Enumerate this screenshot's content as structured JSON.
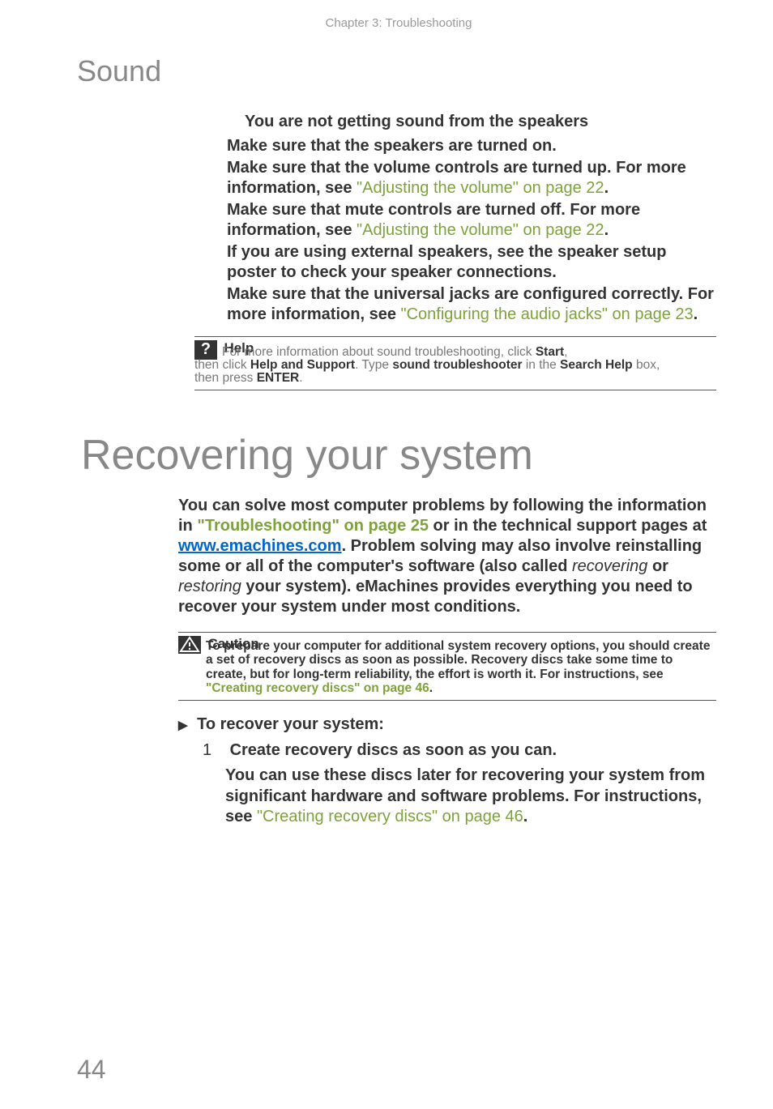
{
  "chapterHeader": "Chapter 3: Troubleshooting",
  "soundTitle": "Sound",
  "issueLine": "You are not getting sound from the speakers",
  "bullets": [
    {
      "text": "Make sure that the speakers are turned on."
    },
    {
      "prefix": "Make sure that the volume controls are turned up. For more information, see ",
      "link": "\"Adjusting the volume\" on page 22",
      "suffix": "."
    },
    {
      "prefix": "Make sure that mute controls are turned off. For more information, see ",
      "link": "\"Adjusting the volume\" on page 22",
      "suffix": "."
    },
    {
      "text": "If you are using external speakers, see the speaker setup poster to check your speaker connections."
    },
    {
      "prefix": "Make sure that the universal jacks are configured correctly. For more information, see ",
      "link": "\"Configuring the audio jacks\" on page 23",
      "suffix": "."
    }
  ],
  "help": {
    "title": "Help",
    "line1a": "For more information about sound troubleshooting, click ",
    "start": "Start",
    "comma1": ",",
    "line2a": "then click ",
    "hs": "Help and Support",
    "line2b": ". Type ",
    "sound": "sound troubleshooter",
    "line2c": " in the ",
    "search": "Search Help",
    "line2d": " box,",
    "line3a": "then press ",
    "enter": "ENTER",
    "period": "."
  },
  "recoveringTitle": "Recovering your system",
  "mainPara": {
    "p1": "You can solve most computer problems by following the information in ",
    "link1": "\"Troubleshooting\" on page 25",
    "p2": " or in the technical support pages at ",
    "url": "www.emachines.com",
    "p3": ". Problem solving may also involve reinstalling some or all of the computer's software (also called ",
    "i1": "recovering",
    "p4": " or ",
    "i2": "restoring",
    "p5": " your system). eMachines provides everything you need to recover your system under most conditions."
  },
  "caution": {
    "title": "Caution",
    "body1": "To prepare your computer for additional system recovery options, you should create a set of recovery discs as soon as possible. Recovery discs take some time to create, but for long-term reliability, the effort is worth it. For instructions, see ",
    "link": "\"Creating recovery discs\" on page 46",
    "body2": "."
  },
  "procTitle": "To recover your system:",
  "step1Num": "1",
  "step1Text": "Create recovery discs as soon as you can.",
  "step1Body1": "You can use these discs later for recovering your system from significant hardware and software problems. For instructions, see ",
  "step1Link": "\"Creating recovery discs\" on page 46",
  "step1Body2": ".",
  "pageNumber": "44"
}
